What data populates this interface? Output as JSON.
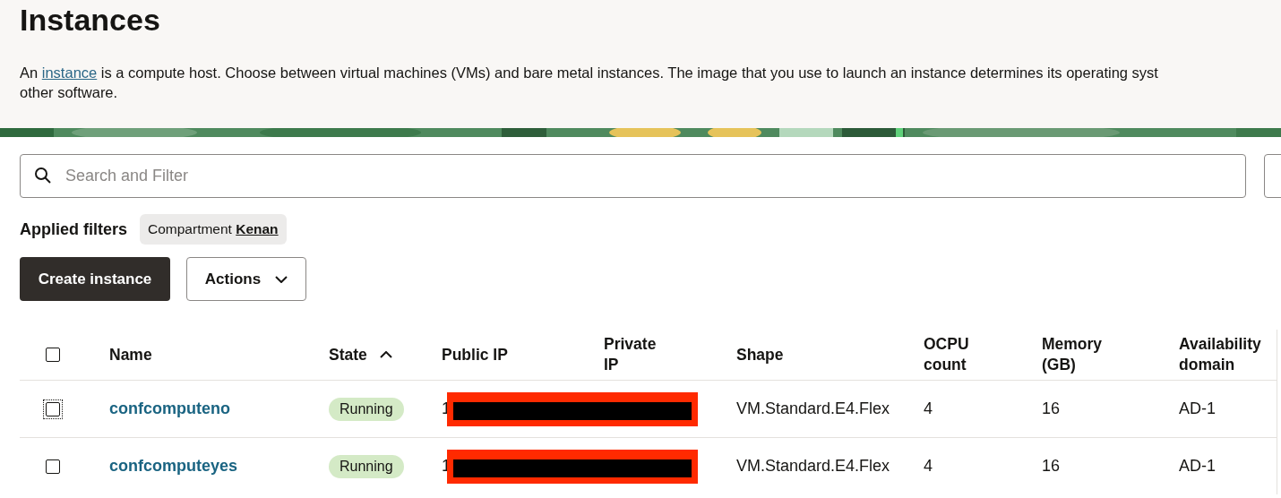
{
  "title": "Instances",
  "description": {
    "before": "An",
    "link": "instance",
    "after": "is a compute host. Choose between virtual machines (VMs) and bare metal instances. The image that you use to launch an instance determines its operating syst",
    "line_2": "other software."
  },
  "search": {
    "placeholder": "Search and Filter"
  },
  "applied_filters": {
    "label": "Applied filters",
    "chips": [
      {
        "name": "Compartment",
        "value": "Kenan"
      }
    ]
  },
  "buttons": [
    {
      "label": "Create instance",
      "kind": "primary"
    },
    {
      "label": "Actions",
      "kind": "menu"
    }
  ],
  "table": {
    "columns": [
      {
        "label": "Name",
        "sorted": false
      },
      {
        "label": "State",
        "sorted": true
      },
      {
        "label": "Public IP",
        "sorted": false
      },
      {
        "label": "Private IP",
        "sorted": false
      },
      {
        "label": "Shape",
        "sorted": false
      },
      {
        "label": "OCPU count",
        "sorted": false
      },
      {
        "label": "Memory (GB)",
        "sorted": false
      },
      {
        "label": "Availability domain",
        "sorted": false
      }
    ],
    "header_checked": false,
    "rows": [
      {
        "checked": false,
        "focused": true,
        "name": "confcomputeno",
        "state": "Running",
        "public_ip": "1",
        "redacted": true,
        "shape": "VM.Standard.E4.Flex",
        "ocpu": "4",
        "memory": "16",
        "ad": "AD-1"
      },
      {
        "checked": false,
        "focused": false,
        "name": "confcomputeyes",
        "state": "Running",
        "public_ip": "1",
        "redacted": true,
        "shape": "VM.Standard.E4.Flex",
        "ocpu": "4",
        "memory": "16",
        "ad": "AD-1"
      }
    ]
  }
}
